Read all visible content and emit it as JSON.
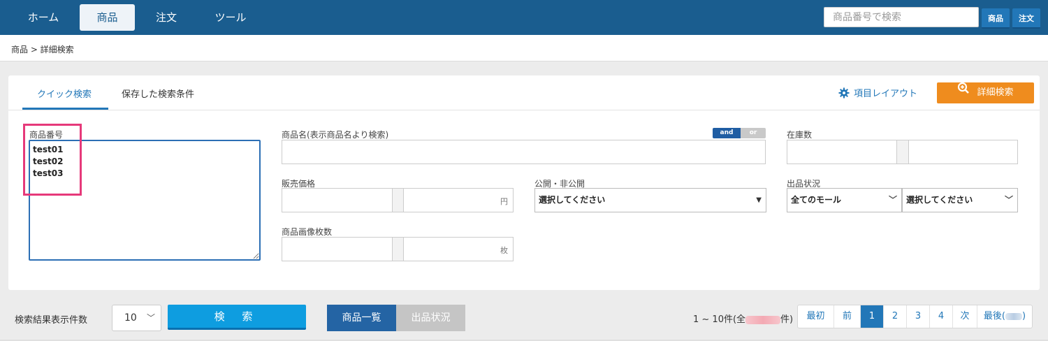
{
  "nav": {
    "tabs": [
      "ホーム",
      "商品",
      "注文",
      "ツール"
    ],
    "active_index": 1,
    "search_placeholder": "商品番号で検索",
    "search_value": "",
    "btn_product": "商品",
    "btn_order": "注文"
  },
  "breadcrumb": "商品 > 詳細検索",
  "panel": {
    "tab_quick": "クイック検索",
    "tab_saved": "保存した検索条件",
    "layout_link": "項目レイアウト",
    "detail_search": "詳細検索",
    "fields": {
      "product_number_label": "商品番号",
      "product_number_value": "test01\ntest02\ntest03",
      "product_name_label": "商品名(表示商品名より検索)",
      "and_label": "and",
      "or_label": "or",
      "stock_label": "在庫数",
      "price_label": "販売価格",
      "price_unit": "円",
      "visibility_label": "公開・非公開",
      "visibility_value": "選択してください",
      "listing_status_label": "出品状況",
      "mall_value": "全てのモール",
      "status_value": "選択してください",
      "image_count_label": "商品画像枚数",
      "image_count_unit": "枚"
    }
  },
  "bottom": {
    "results_per_page_label": "検索結果表示件数",
    "results_per_page_value": "10",
    "search_button": "検 索",
    "view_list": "商品一覧",
    "view_listing": "出品状況",
    "result_prefix": "1 ~ 10件(全",
    "result_suffix": "件)",
    "pager": {
      "first": "最初",
      "prev": "前",
      "pages": [
        "1",
        "2",
        "3",
        "4"
      ],
      "active_page": "1",
      "next": "次",
      "last_prefix": "最後(",
      "last_suffix": ")"
    }
  },
  "colors": {
    "nav_bg": "#1a5d8f",
    "accent_blue": "#2277b8",
    "orange": "#ef8c1e",
    "search_btn": "#0e9de0",
    "highlight": "#e6397a"
  }
}
